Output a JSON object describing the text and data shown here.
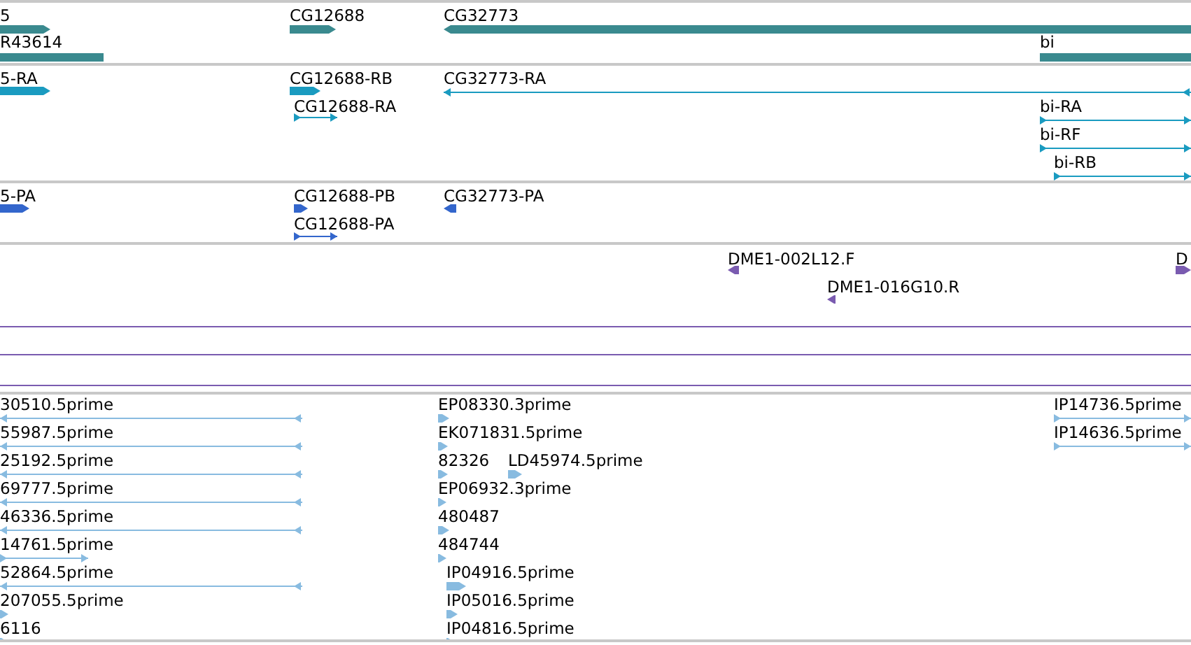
{
  "tracks": [
    {
      "color": "#3a8a8f",
      "features": [
        {
          "label": "5",
          "kind": "arrowbar",
          "reverse": false
        },
        {
          "label": "R43614",
          "kind": "bar"
        },
        {
          "label": "CG12688",
          "kind": "arrowbar",
          "reverse": false
        },
        {
          "label": "CG32773",
          "kind": "arrowbar",
          "reverse": true
        },
        {
          "label": "bi",
          "kind": "bar"
        }
      ]
    },
    {
      "color": "#1a9bc0",
      "features": [
        {
          "label": "5-RA",
          "kind": "block",
          "reverse": false
        },
        {
          "label": "CG12688-RB",
          "kind": "block",
          "reverse": false
        },
        {
          "label": "CG12688-RA",
          "kind": "line",
          "reverse": false
        },
        {
          "label": "CG32773-RA",
          "kind": "line",
          "reverse": true
        },
        {
          "label": "bi-RA",
          "kind": "line",
          "reverse": false
        },
        {
          "label": "bi-RF",
          "kind": "line",
          "reverse": false
        },
        {
          "label": "bi-RB",
          "kind": "line",
          "reverse": false
        }
      ]
    },
    {
      "color": "#3366cc",
      "features": [
        {
          "label": "5-PA",
          "kind": "block",
          "reverse": false
        },
        {
          "label": "CG12688-PB",
          "kind": "block",
          "reverse": false
        },
        {
          "label": "CG12688-PA",
          "kind": "line",
          "reverse": false
        },
        {
          "label": "CG32773-PA",
          "kind": "block",
          "reverse": true
        }
      ]
    },
    {
      "color": "#7a5bb0",
      "features": [
        {
          "label": "DME1-002L12.F",
          "kind": "block",
          "reverse": true
        },
        {
          "label": "DME1-016G10.R",
          "kind": "block",
          "reverse": true
        },
        {
          "label": "D",
          "kind": "block",
          "reverse": false
        }
      ]
    },
    {
      "color": "#88bbe0",
      "features": [
        {
          "label": "30510.5prime",
          "kind": "line",
          "reverse": true
        },
        {
          "label": "55987.5prime",
          "kind": "line",
          "reverse": true
        },
        {
          "label": "25192.5prime",
          "kind": "line",
          "reverse": true
        },
        {
          "label": "69777.5prime",
          "kind": "line",
          "reverse": true
        },
        {
          "label": "46336.5prime",
          "kind": "line",
          "reverse": true
        },
        {
          "label": "14761.5prime",
          "kind": "line",
          "reverse": false
        },
        {
          "label": "52864.5prime",
          "kind": "line",
          "reverse": true
        },
        {
          "label": "207055.5prime",
          "kind": "block",
          "reverse": false
        },
        {
          "label": "6116",
          "kind": "block",
          "reverse": false
        },
        {
          "label": "EP08330.3prime",
          "kind": "block",
          "reverse": false
        },
        {
          "label": "EK071831.5prime",
          "kind": "block",
          "reverse": false
        },
        {
          "label": "82326",
          "kind": "block",
          "reverse": false
        },
        {
          "label": "LD45974.5prime",
          "kind": "block",
          "reverse": false
        },
        {
          "label": "EP06932.3prime",
          "kind": "block",
          "reverse": false
        },
        {
          "label": "480487",
          "kind": "block",
          "reverse": false
        },
        {
          "label": "484744",
          "kind": "block",
          "reverse": false
        },
        {
          "label": "IP04916.5prime",
          "kind": "block",
          "reverse": false
        },
        {
          "label": "IP05016.5prime",
          "kind": "block",
          "reverse": false
        },
        {
          "label": "IP04816.5prime",
          "kind": "block",
          "reverse": false
        },
        {
          "label": "IP14736.5prime",
          "kind": "line",
          "reverse": false
        },
        {
          "label": "IP14636.5prime",
          "kind": "line",
          "reverse": false
        }
      ]
    }
  ]
}
